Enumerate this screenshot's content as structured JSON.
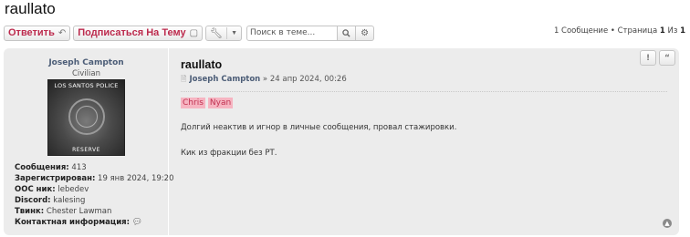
{
  "page": {
    "title": "raullato"
  },
  "toolbar": {
    "reply_label": "Ответить",
    "subscribe_label": "Подписаться На Тему",
    "search": {
      "placeholder": "Поиск в теме...",
      "value": ""
    }
  },
  "pagination": {
    "prefix": "1 Сообщение • Страница ",
    "current": "1",
    "of_label": " Из ",
    "total": "1"
  },
  "post": {
    "author": {
      "name": "Joseph Campton",
      "rank": "Civilian",
      "avatar": {
        "top_text": "LOS SANTOS POLICE",
        "bottom_text": "RESERVE"
      },
      "fields": [
        {
          "label": "Сообщения:",
          "value": "413"
        },
        {
          "label": "Зарегистрирован:",
          "value": "19 янв 2024, 19:20"
        },
        {
          "label": "OOC ник:",
          "value": "lebedev"
        },
        {
          "label": "Discord:",
          "value": "kalesing"
        },
        {
          "label": "Твинк:",
          "value": "Chester Lawman"
        }
      ],
      "contact_label": "Контактная информация:"
    },
    "title": "raullato",
    "meta": {
      "author": "Joseph Campton",
      "date": " » 24 апр 2024, 00:26"
    },
    "tags": [
      "Chris",
      "Nyan"
    ],
    "body": [
      "Долгий неактив и игнор в личные сообщения, провал стажировки.",
      "Кик из фракции без РТ."
    ]
  }
}
